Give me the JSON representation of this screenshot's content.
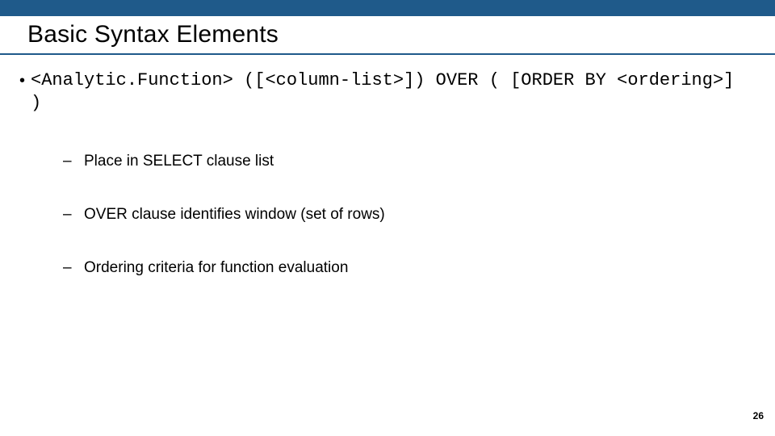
{
  "title": "Basic Syntax Elements",
  "syntax": "<Analytic.Function> ([<column-list>]) OVER ( [ORDER BY <ordering>] )",
  "sub_items": [
    "Place in SELECT clause list",
    "OVER clause identifies window (set of rows)",
    "Ordering criteria for function evaluation"
  ],
  "page_number": "26",
  "glyphs": {
    "bullet": "•",
    "dash": "–"
  }
}
